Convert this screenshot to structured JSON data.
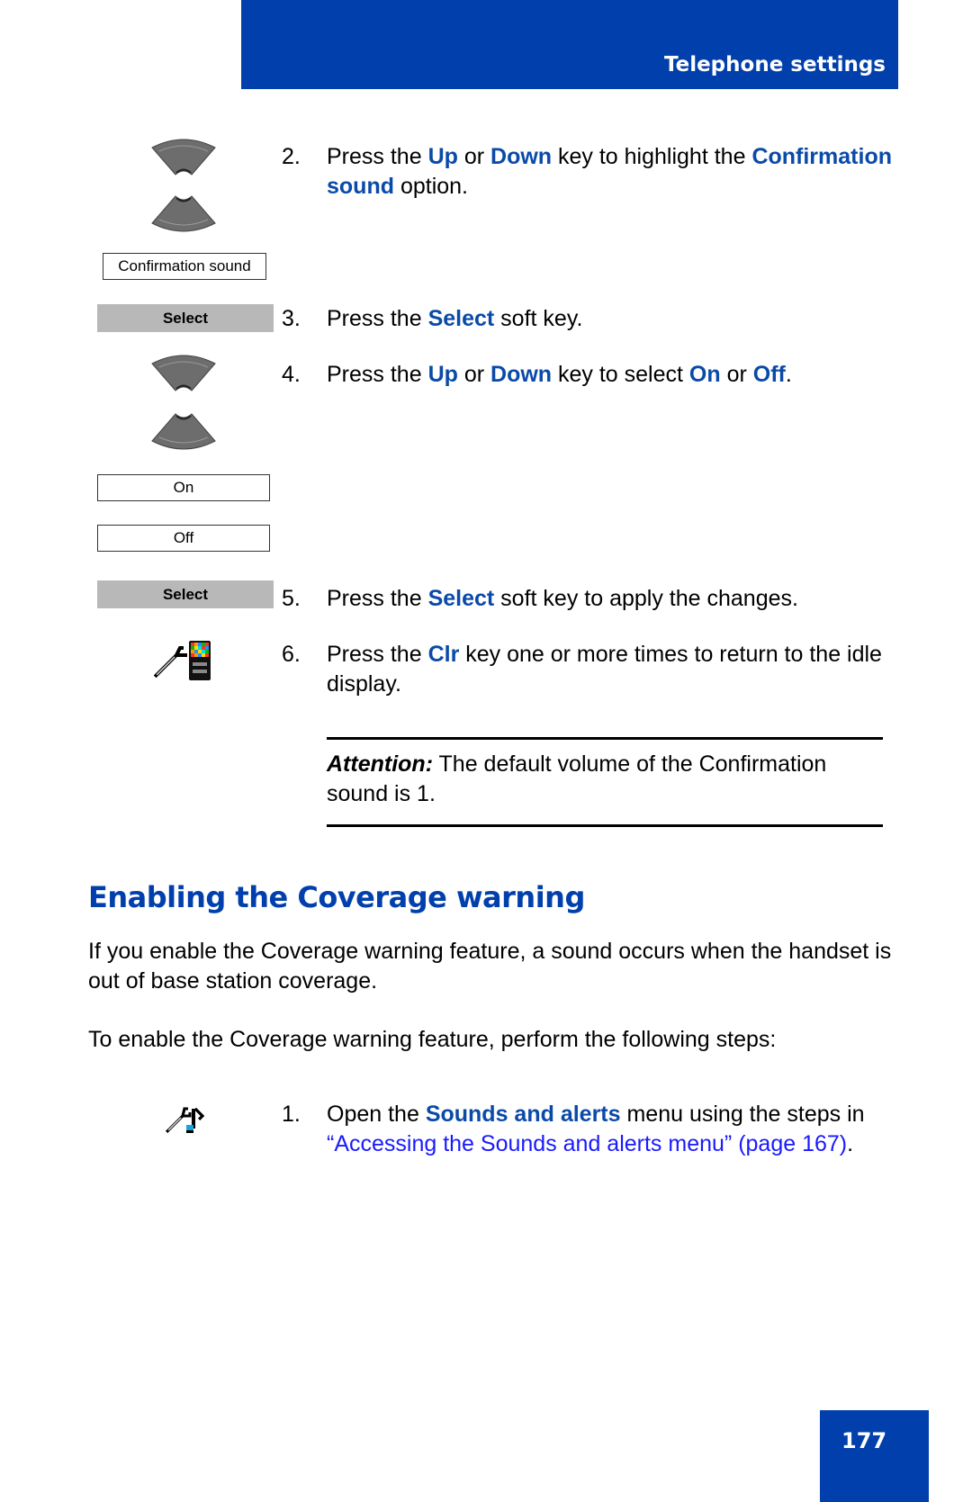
{
  "header": {
    "title": "Telephone settings"
  },
  "icons": {
    "up_key": "up-key-icon",
    "down_key": "down-key-icon",
    "clr_key": "clr-key-icon",
    "sounds_menu": "sounds-and-alerts-icon"
  },
  "left_column": {
    "confirmation_sound_screen": "Confirmation sound",
    "select_softkey_1": "Select",
    "on_option": "On",
    "off_option": "Off",
    "select_softkey_2": "Select"
  },
  "steps_top": [
    {
      "num": "2.",
      "parts": [
        "Press the ",
        "Up",
        " or ",
        "Down",
        " key to highlight the ",
        "Confirmation sound",
        " option."
      ]
    },
    {
      "num": "3.",
      "parts": [
        "Press the ",
        "Select",
        " soft key."
      ]
    },
    {
      "num": "4.",
      "parts": [
        "Press the ",
        "Up",
        " or ",
        "Down",
        " key to select ",
        "On",
        " or ",
        "Off",
        "."
      ]
    },
    {
      "num": "5.",
      "parts": [
        "Press the ",
        "Select",
        " soft key to apply the changes."
      ]
    },
    {
      "num": "6.",
      "parts": [
        "Press the ",
        "Clr",
        " key one or more times to return to the idle display."
      ]
    }
  ],
  "attention": {
    "label": "Attention:",
    "text": " The default volume of the Confirmation sound is 1."
  },
  "section": {
    "title": "Enabling the Coverage warning",
    "intro": "If you enable the Coverage warning feature, a sound occurs when the handset is out of base station coverage.",
    "lead": "To enable the Coverage warning feature, perform the following steps:"
  },
  "steps_bottom": [
    {
      "num": "1.",
      "pre": "Open the ",
      "highlight": "Sounds and alerts",
      "mid": " menu using the steps in ",
      "link": "“Accessing the Sounds and alerts menu” (page 167)",
      "post": "."
    }
  ],
  "footer": {
    "page_number": "177"
  },
  "colors": {
    "brand_blue": "#0140ac",
    "highlight_blue": "#0a4aa8",
    "link_blue": "#1a1aff",
    "softkey_gray": "#b8b8b8"
  }
}
